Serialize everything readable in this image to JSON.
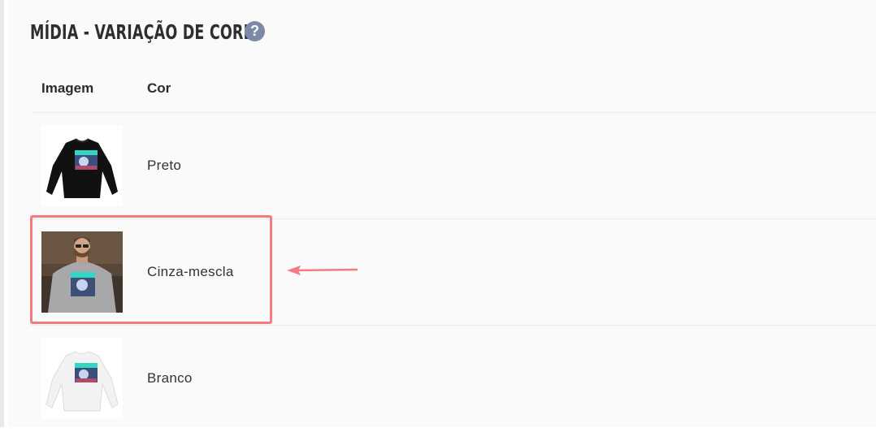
{
  "section": {
    "title": "MÍDIA - VARIAÇÃO DE CORES",
    "help_icon": "question-circle-icon"
  },
  "table": {
    "headers": {
      "image": "Imagem",
      "color": "Cor"
    },
    "rows": [
      {
        "color": "Preto",
        "thumbnail": "black-sweatshirt"
      },
      {
        "color": "Cinza-mescla",
        "thumbnail": "man-wearing-gray-sweatshirt",
        "highlighted": true
      },
      {
        "color": "Branco",
        "thumbnail": "white-sweatshirt"
      }
    ]
  },
  "annotation": {
    "highlight_color": "#f27c7f",
    "arrow_color": "#f27c7f"
  }
}
